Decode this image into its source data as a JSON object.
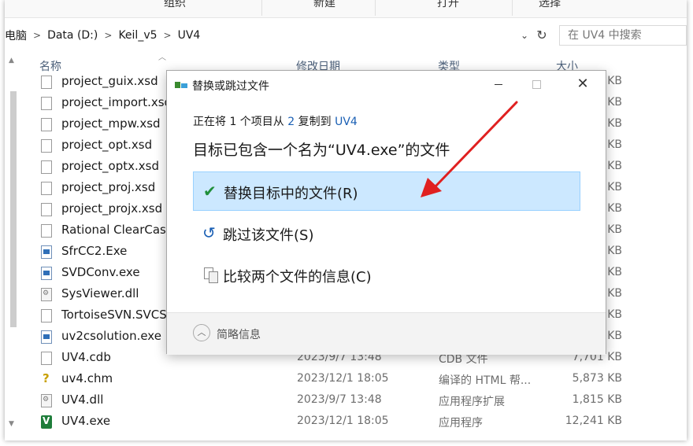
{
  "ribbon": {
    "groups": [
      "组织",
      "新建",
      "打开",
      "选择"
    ]
  },
  "address": {
    "crumbs": [
      "此电脑",
      "Data (D:)",
      "Keil_v5",
      "UV4"
    ],
    "search_placeholder": "在 UV4 中搜索"
  },
  "columns": {
    "name": "名称",
    "modified": "修改日期",
    "type": "类型",
    "size": "大小"
  },
  "files": [
    {
      "name": "project_guix.xsd",
      "icon": "document-icon",
      "date": "",
      "type": "",
      "size": "KB"
    },
    {
      "name": "project_import.xsd",
      "icon": "document-icon",
      "date": "",
      "type": "",
      "size": "KB"
    },
    {
      "name": "project_mpw.xsd",
      "icon": "document-icon",
      "date": "",
      "type": "",
      "size": "KB"
    },
    {
      "name": "project_opt.xsd",
      "icon": "document-icon",
      "date": "",
      "type": "",
      "size": "KB"
    },
    {
      "name": "project_optx.xsd",
      "icon": "document-icon",
      "date": "",
      "type": "",
      "size": "KB"
    },
    {
      "name": "project_proj.xsd",
      "icon": "document-icon",
      "date": "",
      "type": "",
      "size": "KB"
    },
    {
      "name": "project_projx.xsd",
      "icon": "document-icon",
      "date": "",
      "type": "",
      "size": "KB"
    },
    {
      "name": "Rational ClearCase",
      "icon": "document-icon",
      "date": "",
      "type": "",
      "size": "KB"
    },
    {
      "name": "SfrCC2.Exe",
      "icon": "exe-icon",
      "date": "",
      "type": "",
      "size": "KB"
    },
    {
      "name": "SVDConv.exe",
      "icon": "exe-icon",
      "date": "",
      "type": "",
      "size": "KB"
    },
    {
      "name": "SysViewer.dll",
      "icon": "dll-icon",
      "date": "",
      "type": "",
      "size": "KB"
    },
    {
      "name": "TortoiseSVN.SVCS",
      "icon": "document-icon",
      "date": "",
      "type": "",
      "size": "KB"
    },
    {
      "name": "uv2csolution.exe",
      "icon": "exe-icon",
      "date": "",
      "type": "",
      "size": "KB"
    },
    {
      "name": "UV4.cdb",
      "icon": "document-icon",
      "date": "2023/9/7 13:48",
      "type": "CDB 文件",
      "size": "7,701 KB"
    },
    {
      "name": "uv4.chm",
      "icon": "help-file-icon",
      "date": "2023/12/1 18:05",
      "type": "编译的 HTML 帮...",
      "size": "5,873 KB"
    },
    {
      "name": "UV4.dll",
      "icon": "dll-icon",
      "date": "2023/9/7 13:48",
      "type": "应用程序扩展",
      "size": "1,815 KB"
    },
    {
      "name": "UV4.exe",
      "icon": "uv4-app-icon",
      "date": "2023/12/1 18:05",
      "type": "应用程序",
      "size": "12,241 KB"
    }
  ],
  "dialog": {
    "title": "替换或跳过文件",
    "line1_prefix": "正在将 1 个项目从 ",
    "line1_source": "2",
    "line1_mid": " 复制到 ",
    "line1_dest": "UV4",
    "headline": "目标已包含一个名为“UV4.exe”的文件",
    "options": [
      {
        "label": "替换目标中的文件(R)",
        "icon": "check-icon",
        "selected": true
      },
      {
        "label": "跳过该文件(S)",
        "icon": "skip-icon",
        "selected": false
      },
      {
        "label": "比较两个文件的信息(C)",
        "icon": "compare-icon",
        "selected": false
      }
    ],
    "footer": "简略信息"
  },
  "colors": {
    "selected_bg": "#cce8ff",
    "link": "#1a5fb4",
    "annotation_arrow": "#e02020"
  }
}
